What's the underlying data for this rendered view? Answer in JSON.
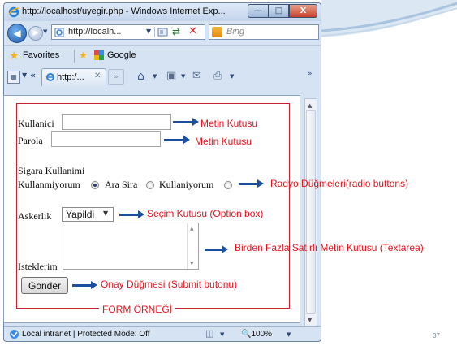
{
  "browser": {
    "title": "http://localhost/uyegir.php - Windows Internet Exp...",
    "window_buttons": {
      "minimize": "—",
      "maximize": "□",
      "close": "X"
    },
    "address": "http://localh...",
    "search_placeholder": "Bing",
    "favorites_label": "Favorites",
    "favorite_link": "Google",
    "tab_label": "http:/...",
    "status_text": "Local intranet | Protected Mode: Off",
    "zoom": "100%"
  },
  "form": {
    "username_label": "Kullanici",
    "password_label": "Parola",
    "smoking_heading": "Sigara Kullanimi",
    "radio_options": [
      "Kullanmiyorum",
      "Ara Sira",
      "Kullaniyorum"
    ],
    "selected_radio": "Kullanmiyorum",
    "military_label": "Askerlik",
    "select_value": "Yapildi",
    "wishes_label": "Isteklerim",
    "submit_label": "Gonder"
  },
  "annotations": {
    "text_box_1": "Metin Kutusu",
    "text_box_2": "Metin Kutusu",
    "radio": "Radyo Düğmeleri(radio buttons)",
    "select": "Seçim Kutusu (Option box)",
    "textarea": "Birden Fazla Satırlı Metin Kutusu (Textarea)",
    "submit": "Onay Düğmesi (Submit butonu)",
    "caption": "FORM ÖRNEĞİ"
  },
  "slide": {
    "page_number": "37"
  },
  "colors": {
    "annotation": "#e5141f",
    "arrow": "#1c4e9e",
    "form_border": "#c4222f"
  }
}
